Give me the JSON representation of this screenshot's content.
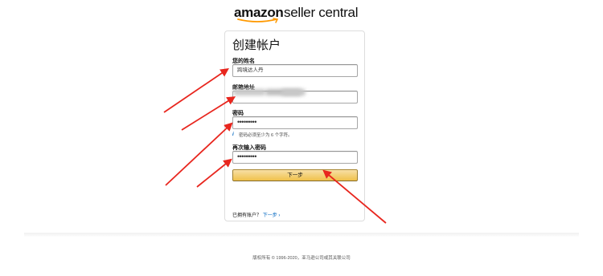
{
  "logo": {
    "bold": "amazon",
    "rest": "seller central"
  },
  "form": {
    "title": "创建帐户",
    "name_label": "您的姓名",
    "name_value": "跨境达人丹",
    "email_label": "邮箱地址",
    "password_label": "密码",
    "password_value": "•••••••••",
    "password_hint": "密码必须至少为 6 个字符。",
    "confirm_label": "再次输入密码",
    "confirm_value": "•••••••••",
    "submit_label": "下一步",
    "signin_prompt": "已拥有账户？",
    "signin_link": "下一步"
  },
  "footer": {
    "text": "版权所有 © 1996-2020，亚马逊公司或其关联公司"
  },
  "colors": {
    "accent": "#f0c14b",
    "link": "#0066c0",
    "arrow": "#e8261e"
  }
}
